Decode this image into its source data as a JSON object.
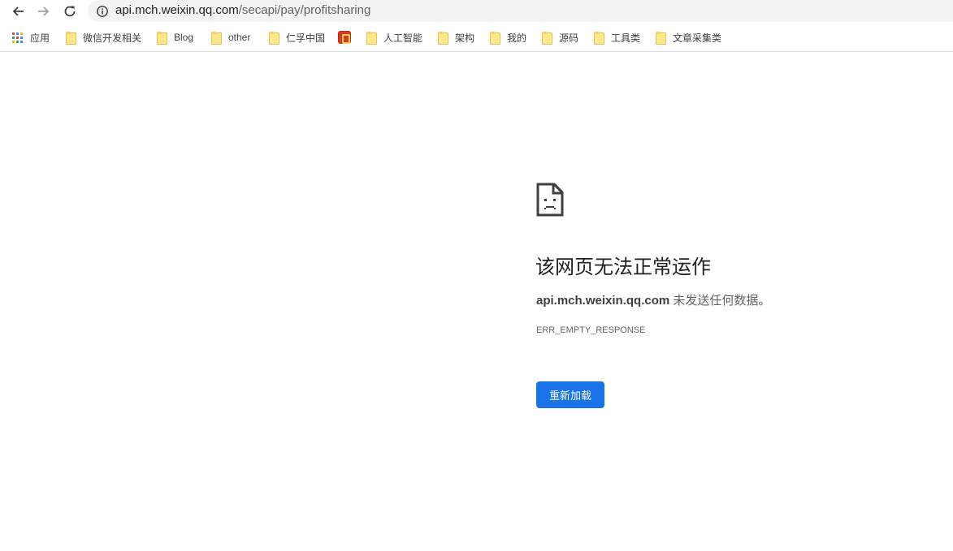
{
  "browser": {
    "address_bar": {
      "host": "api.mch.weixin.qq.com",
      "path": "/secapi/pay/profitsharing"
    }
  },
  "bookmarks": [
    {
      "label": "应用",
      "icon": "apps-grid-icon"
    },
    {
      "label": "微信开发相关",
      "icon": "folder-icon"
    },
    {
      "label": "Blog",
      "icon": "folder-icon"
    },
    {
      "label": "other",
      "icon": "folder-icon"
    },
    {
      "label": "仁孚中国",
      "icon": "folder-icon"
    },
    {
      "label": "",
      "icon": "site-favicon-icon"
    },
    {
      "label": "人工智能",
      "icon": "folder-icon"
    },
    {
      "label": "架构",
      "icon": "folder-icon"
    },
    {
      "label": "我的",
      "icon": "folder-icon"
    },
    {
      "label": "源码",
      "icon": "folder-icon"
    },
    {
      "label": "工具类",
      "icon": "folder-icon"
    },
    {
      "label": "文章采集类",
      "icon": "folder-icon"
    }
  ],
  "error": {
    "title": "该网页无法正常运作",
    "host": "api.mch.weixin.qq.com",
    "message": " 未发送任何数据。",
    "code": "ERR_EMPTY_RESPONSE",
    "reload_label": "重新加载"
  },
  "colors": {
    "accent": "#1a73e8",
    "omnibox_bg": "#f1f3f4",
    "folder": "#fde78a"
  }
}
